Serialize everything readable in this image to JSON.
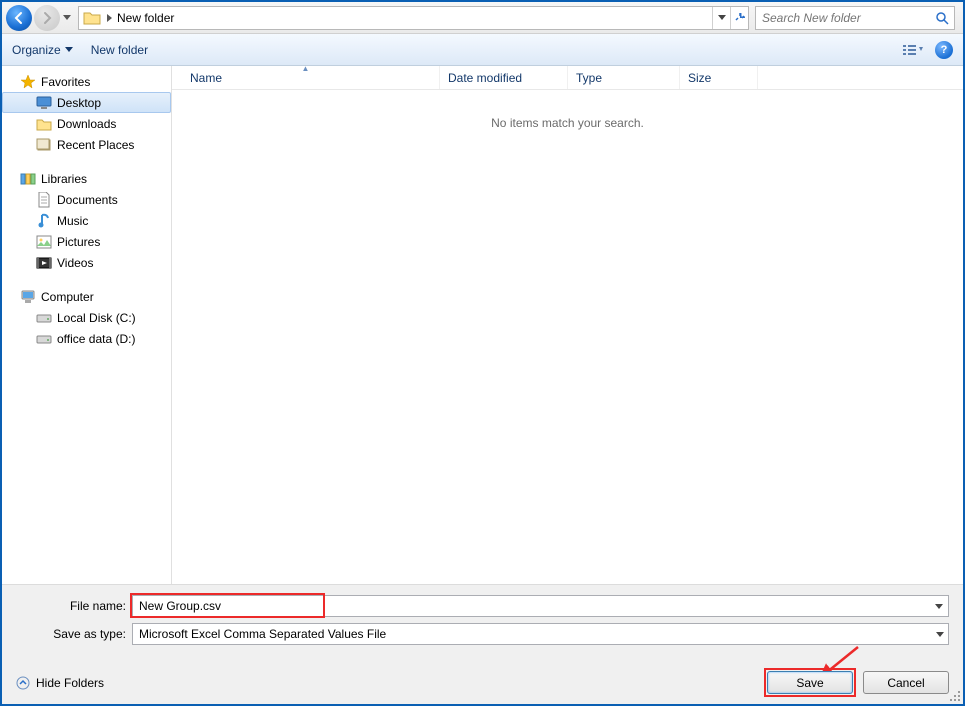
{
  "nav": {
    "addressFolder": "New folder",
    "searchPlaceholder": "Search New folder"
  },
  "toolbar": {
    "organize": "Organize",
    "newFolder": "New folder"
  },
  "tree": {
    "favorites": {
      "label": "Favorites",
      "items": [
        {
          "label": "Desktop",
          "icon": "desktop",
          "selected": true
        },
        {
          "label": "Downloads",
          "icon": "folder-down"
        },
        {
          "label": "Recent Places",
          "icon": "recent"
        }
      ]
    },
    "libraries": {
      "label": "Libraries",
      "items": [
        {
          "label": "Documents",
          "icon": "doc"
        },
        {
          "label": "Music",
          "icon": "music"
        },
        {
          "label": "Pictures",
          "icon": "pic"
        },
        {
          "label": "Videos",
          "icon": "vid"
        }
      ]
    },
    "computer": {
      "label": "Computer",
      "items": [
        {
          "label": "Local Disk (C:)",
          "icon": "drive"
        },
        {
          "label": "office data (D:)",
          "icon": "drive"
        }
      ]
    }
  },
  "columns": {
    "name": "Name",
    "date": "Date modified",
    "type": "Type",
    "size": "Size"
  },
  "content": {
    "emptyMessage": "No items match your search."
  },
  "fields": {
    "fileNameLabel": "File name:",
    "fileNameValue": "New Group.csv",
    "saveAsTypeLabel": "Save as type:",
    "saveAsTypeValue": "Microsoft Excel Comma Separated Values File"
  },
  "buttons": {
    "hideFolders": "Hide Folders",
    "save": "Save",
    "cancel": "Cancel"
  }
}
